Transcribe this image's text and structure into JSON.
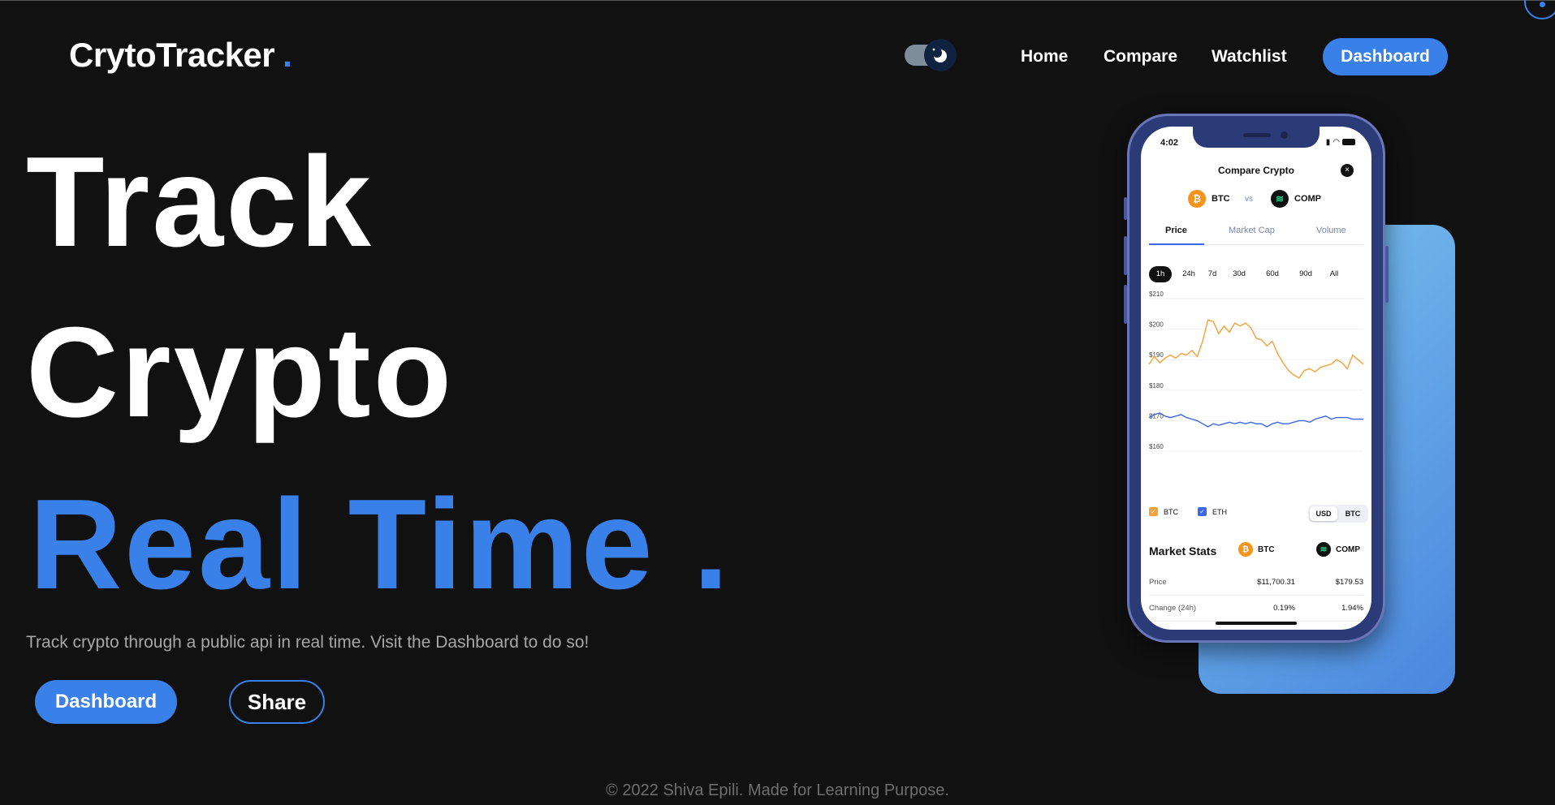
{
  "app": {
    "logo": "CrytoTracker",
    "logo_dot": "."
  },
  "nav": {
    "theme_toggle": "moon-icon",
    "links": [
      "Home",
      "Compare",
      "Watchlist"
    ],
    "dashboard": "Dashboard"
  },
  "hero": {
    "line1": "Track",
    "line2": "Crypto",
    "line3": "Real Time .",
    "tagline": "Track crypto through a public api in real time. Visit the Dashboard to do so!",
    "primary_button": "Dashboard",
    "secondary_button": "Share"
  },
  "footer": {
    "text": "© 2022 Shiva Epili. Made for Learning Purpose."
  },
  "phone": {
    "time": "4:02",
    "title": "Compare Crypto",
    "close": "×",
    "coin_a": "BTC",
    "coin_b": "COMP",
    "vs": "vs",
    "tabs": [
      "Price",
      "Market Cap",
      "Volume"
    ],
    "active_tab": "Price",
    "ranges": [
      "1h",
      "24h",
      "7d",
      "30d",
      "60d",
      "90d",
      "All"
    ],
    "active_range": "1h",
    "legend": [
      "BTC",
      "ETH"
    ],
    "currency": [
      "USD",
      "BTC"
    ],
    "active_currency": "USD",
    "stats_title": "Market Stats",
    "stats": [
      {
        "label": "Price",
        "a": "$11,700.31",
        "b": "$179.53"
      },
      {
        "label": "Change (24h)",
        "a": "0.19%",
        "b": "1.94%"
      }
    ],
    "colors": {
      "btc": "#f7931a",
      "comp": "#111111",
      "series_a": "#f2a33a",
      "series_b": "#3a68e9"
    }
  },
  "chart_data": {
    "type": "line",
    "title": "",
    "xlabel": "",
    "ylabel": "",
    "ylim": [
      160,
      210
    ],
    "yticks": [
      "$210",
      "$200",
      "$190",
      "$180",
      "$170",
      "$160"
    ],
    "x": [
      0,
      1,
      2,
      3,
      4,
      5,
      6,
      7,
      8,
      9,
      10,
      11,
      12,
      13,
      14,
      15,
      16,
      17,
      18,
      19,
      20,
      21,
      22,
      23,
      24,
      25,
      26,
      27,
      28,
      29,
      30,
      31,
      32,
      33,
      34,
      35,
      36,
      37,
      38,
      39,
      40
    ],
    "series": [
      {
        "name": "BTC",
        "values": [
          188.5,
          191,
          189,
          190.5,
          191.5,
          190.5,
          192,
          191.5,
          193,
          191,
          196,
          203,
          202.5,
          198.5,
          201,
          199,
          202,
          201,
          202,
          200.5,
          197,
          196.5,
          194.5,
          196,
          192,
          189,
          186.5,
          185,
          184,
          186.5,
          187,
          186,
          187.5,
          188,
          188.5,
          190,
          189,
          187,
          191.5,
          190,
          188.5
        ]
      },
      {
        "name": "ETH",
        "values": [
          171,
          172,
          172.5,
          171.5,
          171,
          171.5,
          172,
          171,
          170.5,
          170,
          169,
          168,
          169,
          168.5,
          169,
          169.5,
          169,
          169.5,
          169,
          169.5,
          169,
          169,
          168,
          169,
          169.5,
          169,
          169,
          169.5,
          170,
          170,
          169.5,
          170.5,
          171,
          171.5,
          170.5,
          171,
          171,
          171,
          170.5,
          170.5,
          170.5
        ]
      }
    ]
  }
}
